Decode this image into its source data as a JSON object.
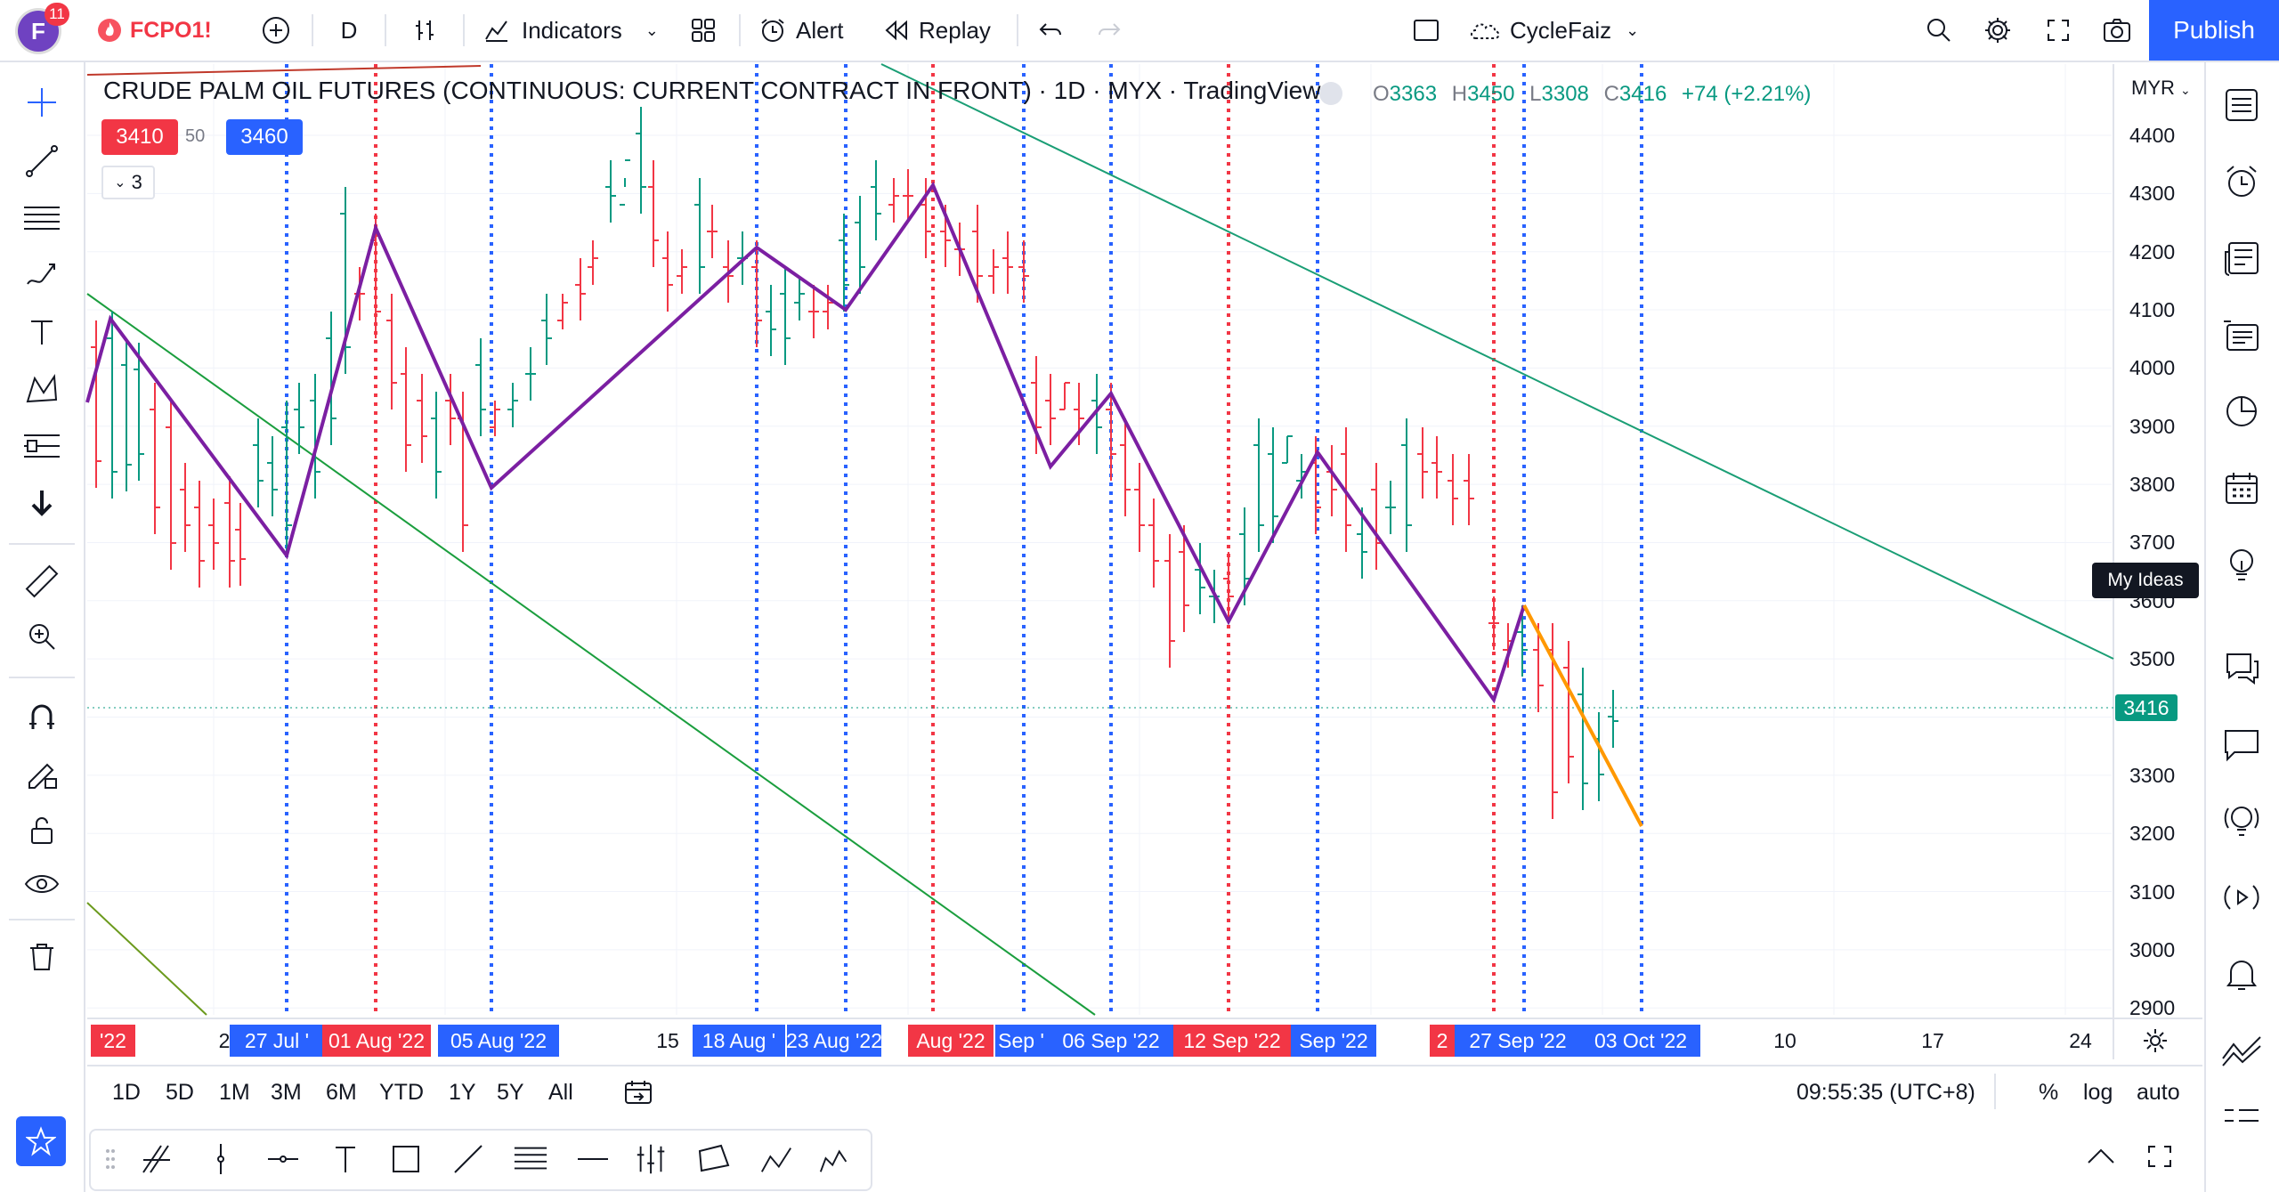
{
  "topbar": {
    "notification_count": "11",
    "avatar_letter": "F",
    "symbol": "FCPO1!",
    "interval": "D",
    "indicators_label": "Indicators",
    "alert_label": "Alert",
    "replay_label": "Replay",
    "layout_name": "CycleFaiz",
    "publish_label": "Publish"
  },
  "legend": {
    "title": "CRUDE PALM OIL FUTURES (CONTINUOUS: CURRENT CONTRACT IN FRONT) · 1D · MYX · TradingView",
    "open_label": "O",
    "open": "3363",
    "high_label": "H",
    "high": "3450",
    "low_label": "L",
    "low": "3308",
    "close_label": "C",
    "close": "3416",
    "change": "+74 (+2.21%)",
    "bid": "3410",
    "spread": "50",
    "ask": "3460",
    "collapse_count": "3"
  },
  "price_axis": {
    "currency": "MYR",
    "labels": [
      "4400",
      "4300",
      "4200",
      "4100",
      "4000",
      "3900",
      "3800",
      "3700",
      "3600",
      "3500",
      "3300",
      "3200",
      "3100",
      "3000",
      "2900"
    ],
    "current_price": "3416"
  },
  "time_axis": {
    "labels": [
      {
        "text": "'22",
        "style": "red"
      },
      {
        "text": "2",
        "style": "plain"
      },
      {
        "text": "27 Jul '",
        "style": "blue"
      },
      {
        "text": "01 Aug '22",
        "style": "red"
      },
      {
        "text": "05 Aug '22",
        "style": "blue"
      },
      {
        "text": "15",
        "style": "plain"
      },
      {
        "text": "18 Aug '",
        "style": "blue"
      },
      {
        "text": "23 Aug '22",
        "style": "blue"
      },
      {
        "text": "Aug '22",
        "style": "red"
      },
      {
        "text": "Sep '",
        "style": "blue"
      },
      {
        "text": "06 Sep '22",
        "style": "blue"
      },
      {
        "text": "12 Sep '22",
        "style": "red"
      },
      {
        "text": "Sep '22",
        "style": "blue"
      },
      {
        "text": "2",
        "style": "red"
      },
      {
        "text": "27 Sep '22",
        "style": "blue"
      },
      {
        "text": "03 Oct '22",
        "style": "blue"
      },
      {
        "text": "10",
        "style": "plain"
      },
      {
        "text": "17",
        "style": "plain"
      },
      {
        "text": "24",
        "style": "plain"
      }
    ]
  },
  "bottom_bar": {
    "ranges": [
      "1D",
      "5D",
      "1M",
      "3M",
      "6M",
      "YTD",
      "1Y",
      "5Y",
      "All"
    ],
    "clock": "09:55:35 (UTC+8)",
    "percent_label": "%",
    "log_label": "log",
    "auto_label": "auto"
  },
  "tooltip": {
    "text": "My Ideas"
  },
  "colors": {
    "up": "#089981",
    "down": "#f23645",
    "accent": "#2962ff",
    "zigzag": "#7b1fa2",
    "zigzag_last": "#ff9800",
    "trend_green": "#1b9e3e",
    "trend_teal": "#1a9e75"
  },
  "icons": {
    "left_toolbar": [
      "crosshair-icon",
      "trendline-icon",
      "fib-icon",
      "brush-icon",
      "text-icon",
      "pattern-icon",
      "forecast-icon",
      "arrow-down-icon",
      "ruler-icon",
      "zoom-in-icon",
      "magnet-icon",
      "lock-drawing-icon",
      "unlock-icon",
      "eye-icon",
      "trash-icon"
    ],
    "right_toolbar": [
      "watchlist-icon",
      "alarm-icon",
      "news-icon",
      "hotlist-icon",
      "data-window-icon",
      "calendar-icon",
      "ideas-icon",
      "chat-icon",
      "chats-icon",
      "idea-stream-icon",
      "streams-icon",
      "notifications-icon",
      "signal-icon"
    ]
  }
}
